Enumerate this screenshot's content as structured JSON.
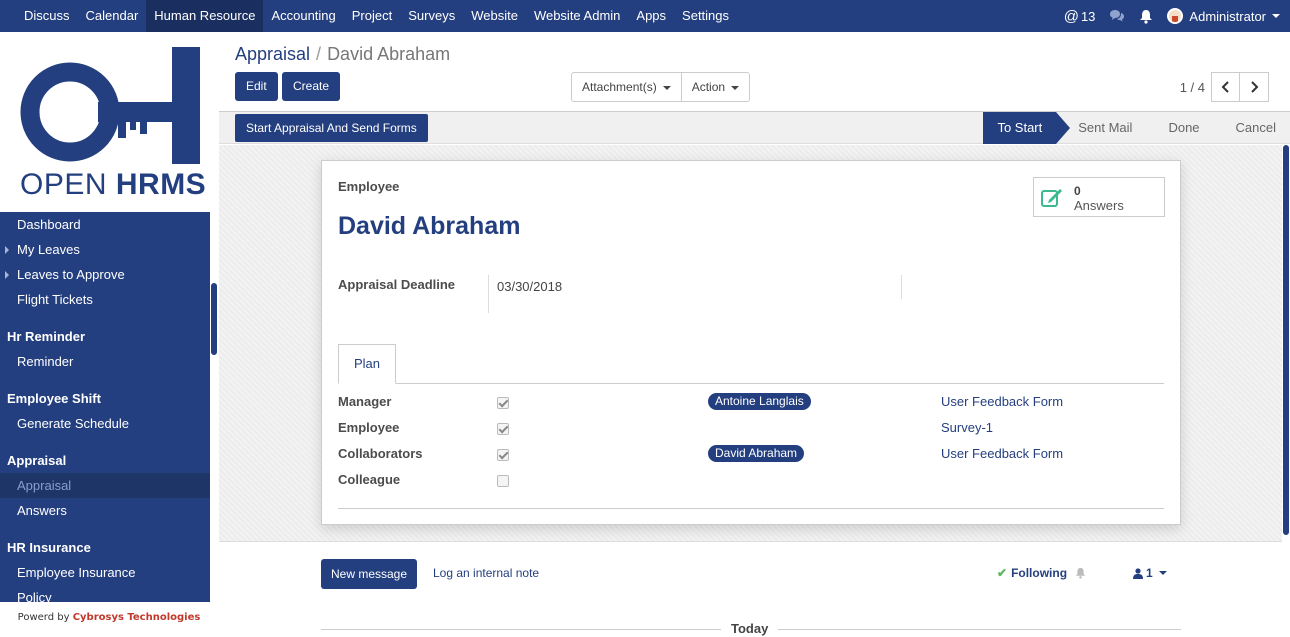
{
  "topbar": {
    "menu": [
      "Discuss",
      "Calendar",
      "Human Resource",
      "Accounting",
      "Project",
      "Surveys",
      "Website",
      "Website Admin",
      "Apps",
      "Settings"
    ],
    "active_menu": "Human Resource",
    "mentions_count": "13",
    "user": "Administrator"
  },
  "logo": {
    "text_light": "OPEN ",
    "text_bold": "HRMS"
  },
  "sidebar": {
    "items": [
      {
        "type": "item",
        "label": "Dashboard",
        "arrow": false
      },
      {
        "type": "item",
        "label": "My Leaves",
        "arrow": true
      },
      {
        "type": "item",
        "label": "Leaves to Approve",
        "arrow": true
      },
      {
        "type": "item",
        "label": "Flight Tickets",
        "arrow": false
      },
      {
        "type": "header",
        "label": "Hr Reminder"
      },
      {
        "type": "item",
        "label": "Reminder",
        "arrow": false
      },
      {
        "type": "header",
        "label": "Employee Shift"
      },
      {
        "type": "item",
        "label": "Generate Schedule",
        "arrow": false
      },
      {
        "type": "header",
        "label": "Appraisal"
      },
      {
        "type": "item",
        "label": "Appraisal",
        "arrow": false,
        "selected": true
      },
      {
        "type": "item",
        "label": "Answers",
        "arrow": false
      },
      {
        "type": "header",
        "label": "HR Insurance"
      },
      {
        "type": "item",
        "label": "Employee Insurance",
        "arrow": false
      },
      {
        "type": "item",
        "label": "Policy",
        "arrow": false
      }
    ],
    "powered_prefix": "Powerd by ",
    "powered_company": "Cybrosys Technologies"
  },
  "control": {
    "breadcrumb_parent": "Appraisal",
    "breadcrumb_sep": "/",
    "breadcrumb_current": "David Abraham",
    "edit_label": "Edit",
    "create_label": "Create",
    "attachments_label": "Attachment(s)",
    "action_label": "Action",
    "pager_value": "1 / 4"
  },
  "statusbar": {
    "start_button": "Start Appraisal And Send Forms",
    "stages": [
      {
        "label": "To Start",
        "active": true
      },
      {
        "label": "Sent Mail",
        "active": false
      },
      {
        "label": "Done",
        "active": false
      },
      {
        "label": "Cancel",
        "active": false
      }
    ]
  },
  "form": {
    "employee_label": "Employee",
    "employee_name": "David Abraham",
    "answers_count": "0",
    "answers_label": "Answers",
    "deadline_label": "Appraisal Deadline",
    "deadline_value": "03/30/2018",
    "tab_label": "Plan",
    "plan_rows": [
      {
        "label": "Manager",
        "checked": true,
        "tag": "Antoine Langlais",
        "survey": "User Feedback Form"
      },
      {
        "label": "Employee",
        "checked": true,
        "tag": "",
        "survey": "Survey-1"
      },
      {
        "label": "Collaborators",
        "checked": true,
        "tag": "David Abraham",
        "survey": "User Feedback Form"
      },
      {
        "label": "Colleague",
        "checked": false,
        "tag": "",
        "survey": ""
      }
    ]
  },
  "chatter": {
    "new_message": "New message",
    "log_note": "Log an internal note",
    "following": "Following",
    "followers_count": "1",
    "today": "Today"
  },
  "colors": {
    "brand": "#243f7f",
    "success": "#5cb85c",
    "stat_icon": "#3db98f"
  }
}
